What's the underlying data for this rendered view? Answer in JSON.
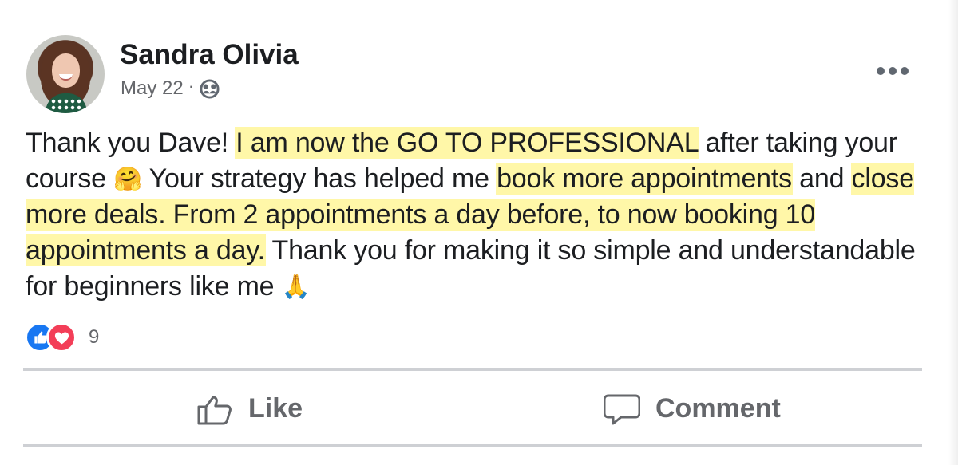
{
  "post": {
    "author": "Sandra Olivia",
    "date": "May 22",
    "separator": "·",
    "audience_icon": "friends-icon",
    "text_segments": [
      "Thank you Dave! ",
      "I am now the GO TO PROFESSIONAL",
      " after taking your course ",
      "🤗",
      " Your strategy has helped me ",
      "book more appointments",
      " and ",
      "close more deals. From 2 appointments a day before, to now booking 10 appointments a day.",
      " Thank you for making it so simple and understandable for beginners like me ",
      "🙏"
    ],
    "highlight_color": "#fff7a8",
    "reaction_count": "9"
  },
  "actions": {
    "like_label": "Like",
    "comment_label": "Comment"
  },
  "colors": {
    "primary_text": "#1c1e21",
    "secondary_text": "#65676b",
    "like_blue": "#1877f2",
    "love_red": "#f33e58",
    "divider": "#ced0d4"
  }
}
